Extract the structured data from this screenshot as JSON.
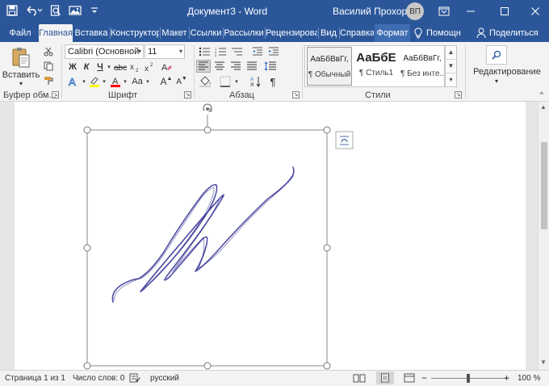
{
  "titlebar": {
    "doc_title": "Документ3 - Word",
    "user_name": "Василий Прохоров",
    "user_initials": "ВП"
  },
  "tabs": [
    {
      "label": "Файл"
    },
    {
      "label": "Главная"
    },
    {
      "label": "Вставка"
    },
    {
      "label": "Конструктор"
    },
    {
      "label": "Макет"
    },
    {
      "label": "Ссылки"
    },
    {
      "label": "Рассылки"
    },
    {
      "label": "Рецензирование"
    },
    {
      "label": "Вид"
    },
    {
      "label": "Справка"
    },
    {
      "label": "Формат"
    }
  ],
  "tellme": {
    "label": "Помощн"
  },
  "share": {
    "label": "Поделиться"
  },
  "clipboard": {
    "paste_label": "Вставить",
    "group_label": "Буфер обм..."
  },
  "font": {
    "font_name": "Calibri (Основной",
    "font_size": "11",
    "bold": "Ж",
    "italic": "К",
    "underline": "Ч",
    "grow": "A",
    "shrink": "A",
    "case": "Aa",
    "clear": "A",
    "group_label": "Шрифт"
  },
  "paragraph": {
    "group_label": "Абзац",
    "pilcrow": "¶"
  },
  "styles": {
    "group_label": "Стили",
    "items": [
      {
        "sample": "АаБбВвГг,",
        "name": "¶ Обычный"
      },
      {
        "sample": "АаБбЕ",
        "name": "¶ Стиль1"
      },
      {
        "sample": "АаБбВвГг,",
        "name": "¶ Без инте..."
      }
    ]
  },
  "editing": {
    "label": "Редактирование"
  },
  "status": {
    "page": "Страница 1 из 1",
    "words": "Число слов: 0",
    "language": "русский",
    "zoom": "100 %"
  },
  "colors": {
    "brand": "#2b579a",
    "highlight": "#ffff00",
    "font_color": "#ff0000",
    "ink": "#3b3897"
  }
}
